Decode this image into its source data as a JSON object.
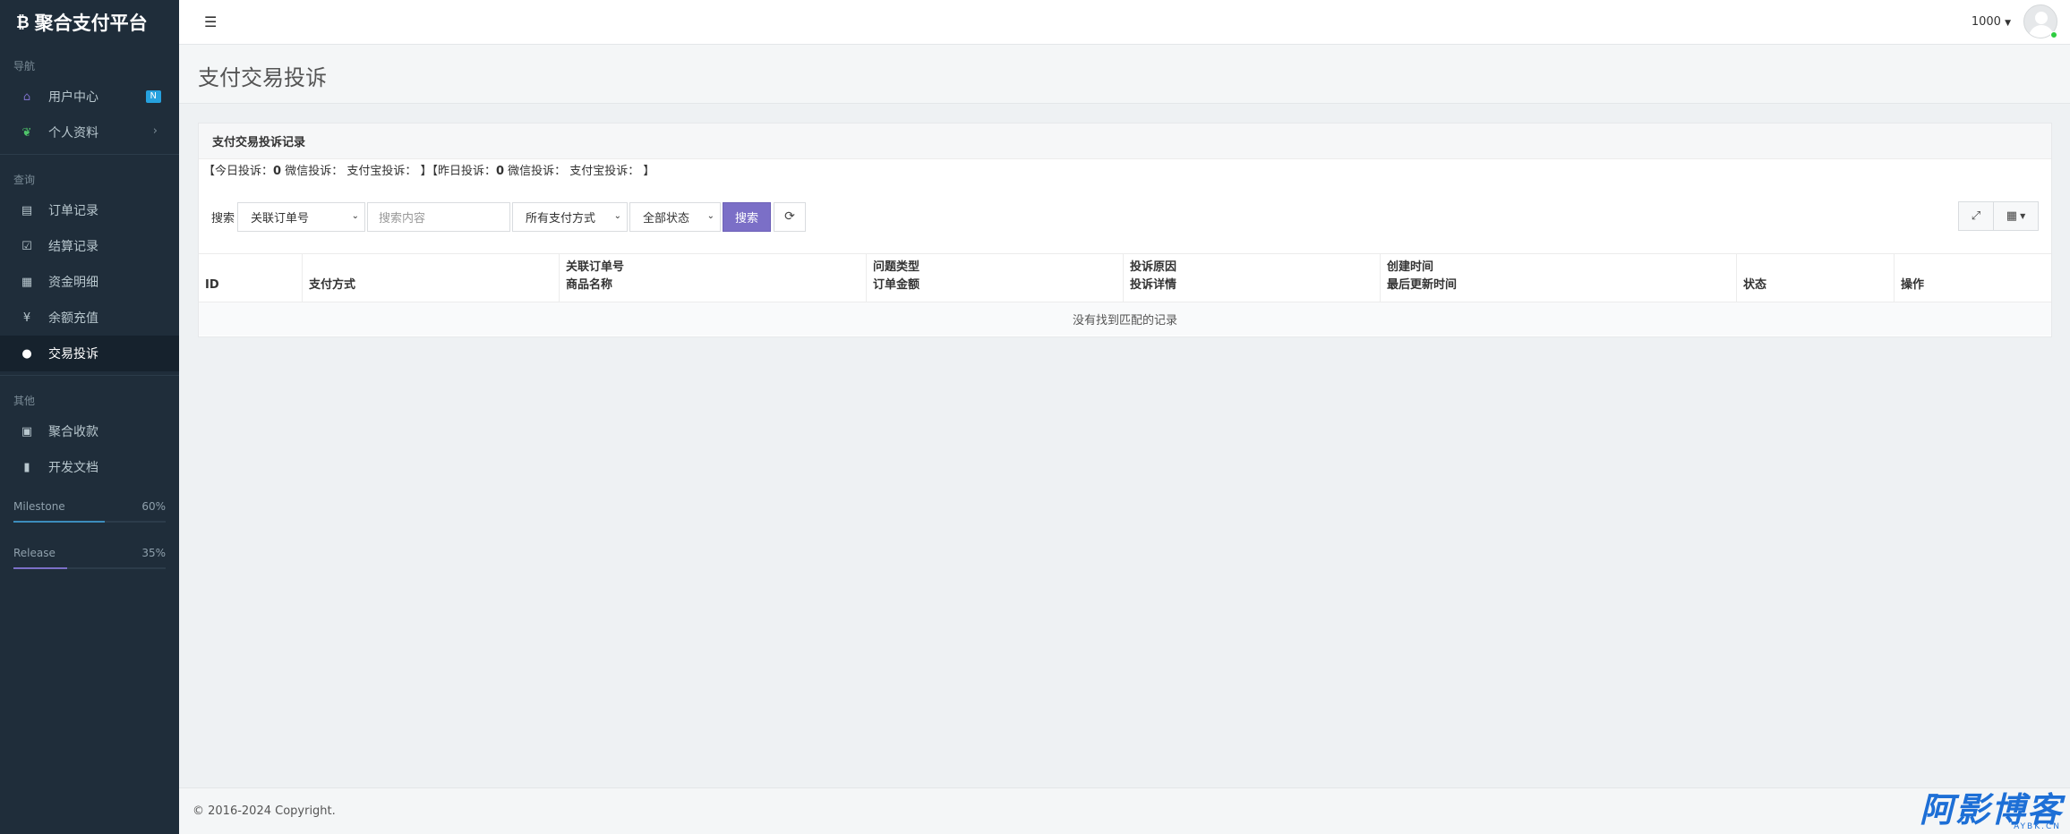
{
  "sidebar": {
    "brand": "聚合支付平台",
    "sections": [
      {
        "title": "导航"
      },
      {
        "title": "查询"
      },
      {
        "title": "其他"
      }
    ],
    "items": [
      {
        "label": "用户中心",
        "badge": "N"
      },
      {
        "label": "个人资料"
      },
      {
        "label": "订单记录"
      },
      {
        "label": "结算记录"
      },
      {
        "label": "资金明细"
      },
      {
        "label": "余额充值"
      },
      {
        "label": "交易投诉"
      },
      {
        "label": "聚合收款"
      },
      {
        "label": "开发文档"
      }
    ],
    "progress": [
      {
        "label": "Milestone",
        "value": "60%",
        "fraction": 0.6,
        "color": "#3c8dbc"
      },
      {
        "label": "Release",
        "value": "35%",
        "fraction": 0.35,
        "color": "#7b6fc7"
      }
    ]
  },
  "topbar": {
    "user": "1000"
  },
  "page": {
    "title": "支付交易投诉"
  },
  "panel": {
    "title": "支付交易投诉记录",
    "stats": {
      "open1": "【今日投诉：",
      "today": "0",
      "mid1": " 微信投诉： 支付宝投诉： 】【昨日投诉：",
      "yesterday": "0",
      "mid2": " 微信投诉： 支付宝投诉： 】"
    },
    "search": {
      "label": "搜索",
      "field_select": "关联订单号",
      "placeholder": "搜索内容",
      "pay_select": "所有支付方式",
      "status_select": "全部状态",
      "search_button": "搜索"
    },
    "table": {
      "columns": [
        {
          "line1": "",
          "line2": "ID"
        },
        {
          "line1": "",
          "line2": "支付方式"
        },
        {
          "line1": "关联订单号",
          "line2": "商品名称"
        },
        {
          "line1": "问题类型",
          "line2": "订单金额"
        },
        {
          "line1": "投诉原因",
          "line2": "投诉详情"
        },
        {
          "line1": "创建时间",
          "line2": "最后更新时间"
        },
        {
          "line1": "",
          "line2": "状态"
        },
        {
          "line1": "",
          "line2": "操作"
        }
      ],
      "empty_text": "没有找到匹配的记录"
    }
  },
  "footer": {
    "copyright": "© 2016-2024 Copyright.",
    "watermark": "阿影博客",
    "watermark_sub": "AYBK.CN"
  }
}
